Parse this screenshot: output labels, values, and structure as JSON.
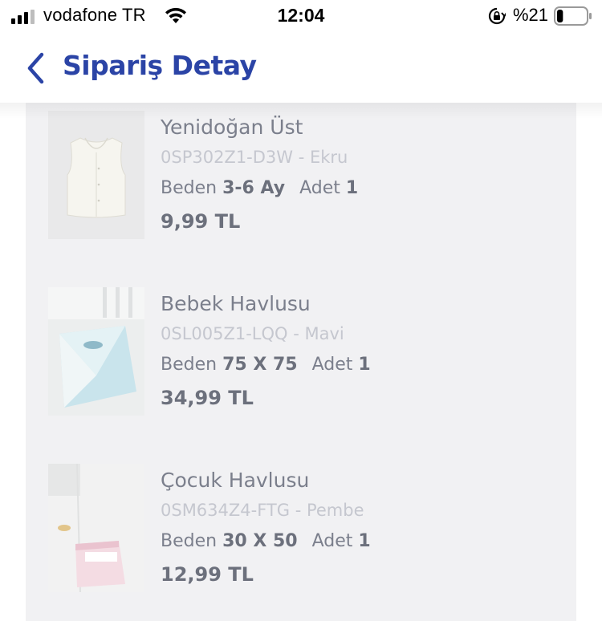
{
  "status_bar": {
    "carrier": "vodafone TR",
    "time": "12:04",
    "battery_text": "%21",
    "battery_level": 0.21
  },
  "nav": {
    "title": "Sipariş Detay"
  },
  "items": [
    {
      "name": "Yenidoğan Üst",
      "sku": "0SP302Z1-D3W - Ekru",
      "size_label": "Beden",
      "size": "3-6 Ay",
      "qty_label": "Adet",
      "qty": "1",
      "price": "9,99 TL"
    },
    {
      "name": "Bebek Havlusu",
      "sku": "0SL005Z1-LQQ - Mavi",
      "size_label": "Beden",
      "size": "75 X 75",
      "qty_label": "Adet",
      "qty": "1",
      "price": "34,99 TL"
    },
    {
      "name": "Çocuk Havlusu",
      "sku": "0SM634Z4-FTG - Pembe",
      "size_label": "Beden",
      "size": "30 X 50",
      "qty_label": "Adet",
      "qty": "1",
      "price": "12,99 TL"
    }
  ]
}
